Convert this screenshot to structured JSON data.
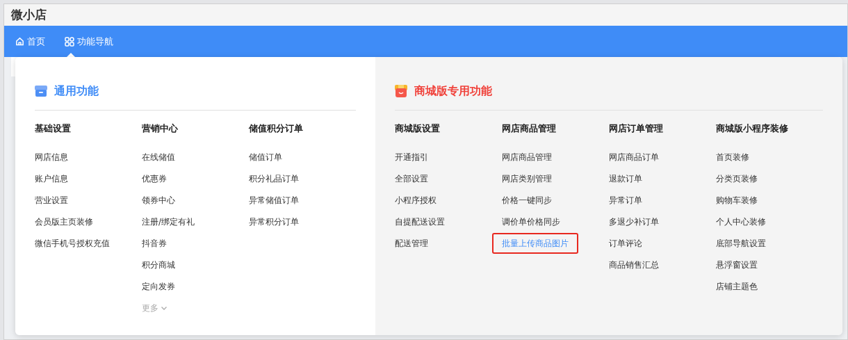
{
  "window": {
    "title": "微小店"
  },
  "nav": [
    {
      "label": "首页",
      "kind": "home"
    },
    {
      "label": "功能导航",
      "kind": "grid"
    }
  ],
  "sections": [
    {
      "kind": "general",
      "title": "通用功能",
      "columns": [
        {
          "title": "基础设置",
          "items": [
            {
              "label": "网店信息",
              "highlighted": false
            },
            {
              "label": "账户信息",
              "highlighted": false
            },
            {
              "label": "营业设置",
              "highlighted": false
            },
            {
              "label": "会员版主页装修",
              "highlighted": false
            },
            {
              "label": "微信手机号授权充值",
              "highlighted": false
            }
          ]
        },
        {
          "title": "营销中心",
          "items": [
            {
              "label": "在线储值",
              "highlighted": false
            },
            {
              "label": "优惠券",
              "highlighted": false
            },
            {
              "label": "领券中心",
              "highlighted": false
            },
            {
              "label": "注册/绑定有礼",
              "highlighted": false
            },
            {
              "label": "抖音券",
              "highlighted": false
            },
            {
              "label": "积分商城",
              "highlighted": false
            },
            {
              "label": "定向发券",
              "highlighted": false
            }
          ],
          "more": "更多"
        },
        {
          "title": "储值积分订单",
          "items": [
            {
              "label": "储值订单",
              "highlighted": false
            },
            {
              "label": "积分礼品订单",
              "highlighted": false
            },
            {
              "label": "异常储值订单",
              "highlighted": false
            },
            {
              "label": "异常积分订单",
              "highlighted": false
            }
          ]
        }
      ]
    },
    {
      "kind": "mall",
      "title": "商城版专用功能",
      "columns": [
        {
          "title": "商城版设置",
          "items": [
            {
              "label": "开通指引",
              "highlighted": false
            },
            {
              "label": "全部设置",
              "highlighted": false
            },
            {
              "label": "小程序授权",
              "highlighted": false
            },
            {
              "label": "自提配送设置",
              "highlighted": false
            },
            {
              "label": "配送管理",
              "highlighted": false
            }
          ]
        },
        {
          "title": "网店商品管理",
          "items": [
            {
              "label": "网店商品管理",
              "highlighted": false
            },
            {
              "label": "网店类别管理",
              "highlighted": false
            },
            {
              "label": "价格一键同步",
              "highlighted": false
            },
            {
              "label": "调价单价格同步",
              "highlighted": false
            },
            {
              "label": "批量上传商品图片",
              "highlighted": true
            }
          ]
        },
        {
          "title": "网店订单管理",
          "items": [
            {
              "label": "网店商品订单",
              "highlighted": false
            },
            {
              "label": "退款订单",
              "highlighted": false
            },
            {
              "label": "异常订单",
              "highlighted": false
            },
            {
              "label": "多退少补订单",
              "highlighted": false
            },
            {
              "label": "订单评论",
              "highlighted": false
            },
            {
              "label": "商品销售汇总",
              "highlighted": false
            }
          ]
        },
        {
          "title": "商城版小程序装修",
          "items": [
            {
              "label": "首页装修",
              "highlighted": false
            },
            {
              "label": "分类页装修",
              "highlighted": false
            },
            {
              "label": "购物车装修",
              "highlighted": false
            },
            {
              "label": "个人中心装修",
              "highlighted": false
            },
            {
              "label": "底部导航设置",
              "highlighted": false
            },
            {
              "label": "悬浮窗设置",
              "highlighted": false
            },
            {
              "label": "店铺主题色",
              "highlighted": false
            }
          ]
        }
      ]
    }
  ]
}
